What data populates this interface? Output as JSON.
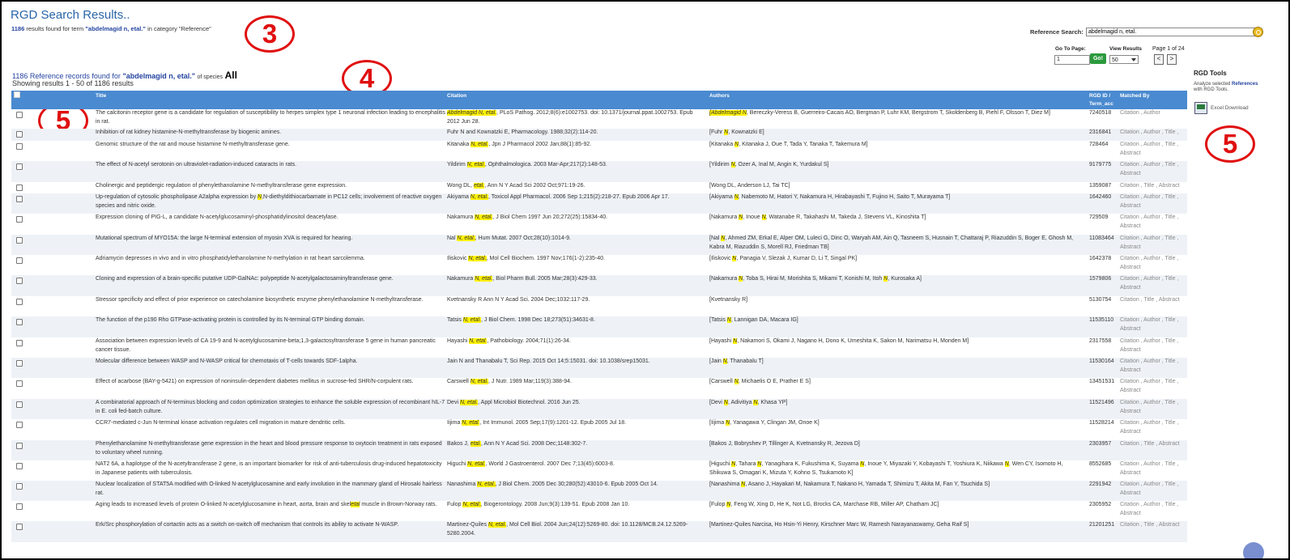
{
  "header": {
    "title": "RGD Search Results..",
    "count": "1186",
    "results_text": "results found for term",
    "term": "\"abdelmagid n, etal.\"",
    "category_text": "in category \"Reference\""
  },
  "search": {
    "label": "Reference Search:",
    "value": "abdelmagid n, etal."
  },
  "pager": {
    "goto_label": "Go To Page:",
    "goto_value": "1",
    "go_label": "Go!",
    "view_label": "View Results",
    "view_value": "50",
    "page_of": "Page 1 of 24",
    "prev": "<",
    "next": ">"
  },
  "records": {
    "found_text": "1186 Reference records found for",
    "term": "\"abdelmagid n, etal.\"",
    "species_text": "of species",
    "species": "All",
    "showing": "Showing results 1 - 50 of 1186 results"
  },
  "callouts": [
    "3",
    "4",
    "5",
    "5"
  ],
  "table": {
    "headers": {
      "title": "Title",
      "citation": "Citation",
      "authors": "Authors",
      "rgd1": "RGD ID /",
      "rgd2": "Term_acc",
      "matched": "Matched By"
    },
    "rows": [
      {
        "title": "The calcitonin receptor gene is a candidate for regulation of susceptibility to herpes simplex type 1 neuronal infection leading to encephalitis in rat.",
        "citation": "[[Abdelmagid N, etal.]], PLoS Pathog. 2012;8(6):e1002753. doi: 10.1371/journal.ppat.1002753. Epub 2012 Jun 28.",
        "authors": "[[[Abdelmagid N]], Bereczky-Veress B, Guerreiro-Cacais AO, Bergman P, Luhr KM, Bergstrom T, Skoldenberg B, Piehl F, Olsson T, Diez M]",
        "rgd": "7240518",
        "matched": "Citation , Author",
        "h": 24
      },
      {
        "title": "Inhibition of rat kidney histamine-N-methyltransferase by biogenic amines.",
        "citation": "Fuhr N and Kownatzki E, Pharmacology. 1988;32(2):114-20.",
        "authors": "[Fuhr [[N]], Kownatzki E]",
        "rgd": "2316841",
        "matched": "Citation , Author , Title ,",
        "h": 15
      },
      {
        "title": "Genomic structure of the rat and mouse histamine N-methyltransferase gene.",
        "citation": "Kitanaka [[N, etal.]], Jpn J Pharmacol 2002 Jan;88(1):85-92.",
        "authors": "[Kitanaka [[N]], Kitanaka J, Oue T, Tada Y, Tanaka T, Takemura M]",
        "rgd": "728464",
        "matched": "Citation , Author , Title , Abstract",
        "h": 25
      },
      {
        "title": "The effect of N-acetyl serotonin on ultraviolet-radiation-induced cataracts in rats.",
        "citation": "Yildirim [[N, etal.]], Ophthalmologica. 2003 Mar-Apr;217(2):148-53.",
        "authors": "[Yildirim [[N]], Ozer A, Inal M, Angin K, Yurdakul S]",
        "rgd": "9179775",
        "matched": "Citation , Author , Title , Abstract",
        "h": 26
      },
      {
        "title": "Cholinergic and peptidergic regulation of phenylethanolamine N-methyltransferase gene expression.",
        "citation": "Wong DL, [[etal.]], Ann N Y Acad Sci 2002 Oct;971:19-26.",
        "authors": "[Wong DL, Anderson LJ, Tai TC]",
        "rgd": "1359087",
        "matched": "Citation , Title , Abstract",
        "h": 14
      },
      {
        "title": "Up-regulation of cytosolic phospholipase A2alpha expression by [[N]],N-diethyldithiocarbamate in PC12 cells; involvement of reactive oxygen species and nitric oxide.",
        "citation": "Akiyama [[N, etal.]], Toxicol Appl Pharmacol. 2006 Sep 1;215(2):218-27. Epub 2006 Apr 17.",
        "authors": "[Akiyama [[N]], Nabemoto M, Hatori Y, Nakamura H, Hirabayashi T, Fujino H, Saito T, Murayama T]",
        "rgd": "1642460",
        "matched": "Citation , Author , Title , Abstract",
        "h": 25
      },
      {
        "title": "Expression cloning of PIG-L, a candidate N-acetylglucosaminyl-phosphatidylinositol deacetylase.",
        "citation": "Nakamura [[N, etal.]], J Biol Chem 1997 Jun 20;272(25):15834-40.",
        "authors": "[Nakamura [[N]], Inoue [[N]], Watanabe R, Takahashi M, Takeda J, Stevens VL, Kinoshita T]",
        "rgd": "729509",
        "matched": "Citation , Author , Title , Abstract",
        "h": 26
      },
      {
        "title": "Mutational spectrum of MYO15A: the large N-terminal extension of myosin XVA is required for hearing.",
        "citation": "Nal [[N, etal.]], Hum Mutat. 2007 Oct;28(10):1014-9.",
        "authors": "[Nal [[N]], Ahmed ZM, Erkal E, Alper OM, Luleci G, Dinc O, Waryah AM, Ain Q, Tasneem S, Husnain T, Chattaraj P, Riazuddin S, Boger E, Ghosh M, Kabra M, Riazuddin S, Morell RJ, Friedman TB]",
        "rgd": "11083464",
        "matched": "Citation , Author , Title , Abstract",
        "h": 25
      },
      {
        "title": "Adriamycin depresses in vivo and in vitro phosphatidylethanolamine N-methylation in rat heart sarcolemma.",
        "citation": "Iliskovic [[N, etal.]], Mol Cell Biochem. 1997 Nov;176(1-2):235-40.",
        "authors": "[Iliskovic [[N]], Panagia V, Slezak J, Kumar D, Li T, Singal PK]",
        "rgd": "1642378",
        "matched": "Citation , Author , Title , Abstract",
        "h": 25
      },
      {
        "title": "Cloning and expression of a brain-specific putative UDP-GalNAc: polypeptide N-acetylgalactosaminyltransferase gene.",
        "citation": "Nakamura [[N, etal.]], Biol Pharm Bull. 2005 Mar;28(3):429-33.",
        "authors": "[Nakamura [[N]], Toba S, Hirai M, Morishita S, Mikami T, Konishi M, Itoh [[N]], Kurosaka A]",
        "rgd": "1579806",
        "matched": "Citation , Author , Title , Abstract",
        "h": 26
      },
      {
        "title": "Stressor specificity and effect of prior experience on catecholamine biosynthetic enzyme phenylethanolamine N-methyltransferase.",
        "citation": "Kvetnansky R Ann N Y Acad Sci. 2004 Dec;1032:117-29.",
        "authors": "[Kvetnansky R]",
        "rgd": "5130754",
        "matched": "Citation , Title , Abstract",
        "h": 25
      },
      {
        "title": "The function of the p190 Rho GTPase-activating protein is controlled by its N-terminal GTP binding domain.",
        "citation": "Tatsis [[N, etal.]], J Biol Chem. 1998 Dec 18;273(51):34631-8.",
        "authors": "[Tatsis [[N]], Lannigan DA, Macara IG]",
        "rgd": "11535110",
        "matched": "Citation , Author , Title , Abstract",
        "h": 26
      },
      {
        "title": "Association between expression levels of CA 19-9 and N-acetylglucosamine-beta;1,3-galactosyltransferase 5 gene in human pancreatic cancer tissue.",
        "citation": "Hayashi [[N, etal.]], Pathobiology. 2004;71(1):26-34.",
        "authors": "[Hayashi [[N]], Nakamori S, Okami J, Nagano H, Dono K, Umeshita K, Sakon M, Narimatsu H, Monden M]",
        "rgd": "2317558",
        "matched": "Citation , Author , Title , Abstract",
        "h": 25
      },
      {
        "title": "Molecular difference between WASP and N-WASP critical for chemotaxis of T-cells towards SDF-1alpha.",
        "citation": "Jain N and Thanabalu T, Sci Rep. 2015 Oct 14;5:15031. doi: 10.1038/srep15031.",
        "authors": "[Jain [[N]], Thanabalu T]",
        "rgd": "11530164",
        "matched": "Citation , Author , Title , Abstract",
        "h": 25
      },
      {
        "title": "Effect of acarbose (BAY-g-5421) on expression of noninsulin-dependent diabetes mellitus in sucrose-fed SHR/N-corpulent rats.",
        "citation": "Carswell [[N, etal.]], J Nutr. 1989 Mar;119(3):388-94.",
        "authors": "[Carswell [[N]], Michaelis O E, Prather E S]",
        "rgd": "13451531",
        "matched": "Citation , Author , Title , Abstract",
        "h": 26
      },
      {
        "title": "A combinatorial approach of N-terminus blocking and codon optimization strategies to enhance the soluble expression of recombinant hIL-7 in E. coli fed-batch culture.",
        "citation": "Devi [[N, etal.]], Appl Microbiol Biotechnol. 2016 Jun 25.",
        "authors": "[Devi [[N]], Adivitiya [[N]], Khasa YP]",
        "rgd": "11521496",
        "matched": "Citation , Author , Title , Abstract",
        "h": 25
      },
      {
        "title": "CCR7-mediated c-Jun N-terminal kinase activation regulates cell migration in mature dendritic cells.",
        "citation": "Iijima [[N, etal.]], Int Immunol. 2005 Sep;17(9):1201-12. Epub 2005 Jul 18.",
        "authors": "[Iijima [[N]], Yanagawa Y, Clingan JM, Onoe K]",
        "rgd": "11528214",
        "matched": "Citation , Author , Title , Abstract",
        "h": 26
      },
      {
        "title": "Phenylethanolamine N-methyltransferase gene expression in the heart and blood pressure response to oxytocin treatment in rats exposed to voluntary wheel running.",
        "citation": "Bakos J, [[etal.]], Ann N Y Acad Sci. 2008 Dec;1148:302-7.",
        "authors": "[Bakos J, Bobryshev P, Tillinger A, Kvetnansky R, Jezova D]",
        "rgd": "2303957",
        "matched": "Citation , Title , Abstract",
        "h": 25
      },
      {
        "title": "NAT2 6A, a haplotype of the N-acetyltransferase 2 gene, is an important biomarker for risk of anti-tuberculosis drug-induced hepatotoxicity in Japanese patients with tuberculosis.",
        "citation": "Higuchi [[N, etal.]], World J Gastroenterol. 2007 Dec 7;13(45):6003-8.",
        "authors": "[Higuchi [[N]], Tahara [[N]], Yanagihara K, Fukushima K, Suyama [[N]], Inoue Y, Miyazaki Y, Kobayashi T, Yoshiura K, Niikawa [[N]], Wen CY, Isomoto H, Shikuwa S, Omagari K, Mizuta Y, Kohno S, Tsukamoto K]",
        "rgd": "8552685",
        "matched": "Citation , Author , Title , Abstract",
        "h": 25
      },
      {
        "title": "Nuclear localization of STAT5A modified with O-linked N-acetylglucosamine and early involution in the mammary gland of Hirosaki hairless rat.",
        "citation": "Nanashima [[N, etal.]], J Biol Chem. 2005 Dec 30;280(52):43010-6. Epub 2005 Oct 14.",
        "authors": "[Nanashima [[N]], Asano J, Hayakari M, Nakamura T, Nakano H, Yamada T, Shimizu T, Akita M, Fan Y, Tsuchida S]",
        "rgd": "2291942",
        "matched": "Citation , Author , Title , Abstract",
        "h": 25
      },
      {
        "title": "Aging leads to increased levels of protein O-linked N-acetylglucosamine in heart, aorta, brain and skel[[etal]] muscle in Brown-Norway rats.",
        "citation": "Fulop [[N, etal.]], Biogerontology. 2008 Jun;9(3):139-51. Epub 2008 Jan 10.",
        "authors": "[Fulop [[N]], Feng W, Xing D, He K, Not LG, Brocks CA, Marchase RB, Miller AP, Chatham JC]",
        "rgd": "2305952",
        "matched": "Citation , Author , Title , Abstract",
        "h": 25
      },
      {
        "title": "Erk/Src phosphorylation of cortactin acts as a switch on-switch off mechanism that controls its ability to activate N-WASP.",
        "citation": "Martinez-Quiles [[N, etal.]], Mol Cell Biol. 2004 Jun;24(12):5269-80. doi: 10.1128/MCB.24.12.5269-5280.2004.",
        "authors": "[Martinez-Quiles Narcisa, Ho Hsin-Yi Henry, Kirschner Marc W, Ramesh Narayanaswamy, Geha Raif S]",
        "rgd": "21201251",
        "matched": "Citation , Title , Abstract",
        "h": 26
      }
    ]
  },
  "tools": {
    "title": "RGD Tools",
    "desc_pre": "Analyze selected",
    "desc_link": "References",
    "desc_post": "with RGD Tools.",
    "excel_label": "Excel Download"
  }
}
